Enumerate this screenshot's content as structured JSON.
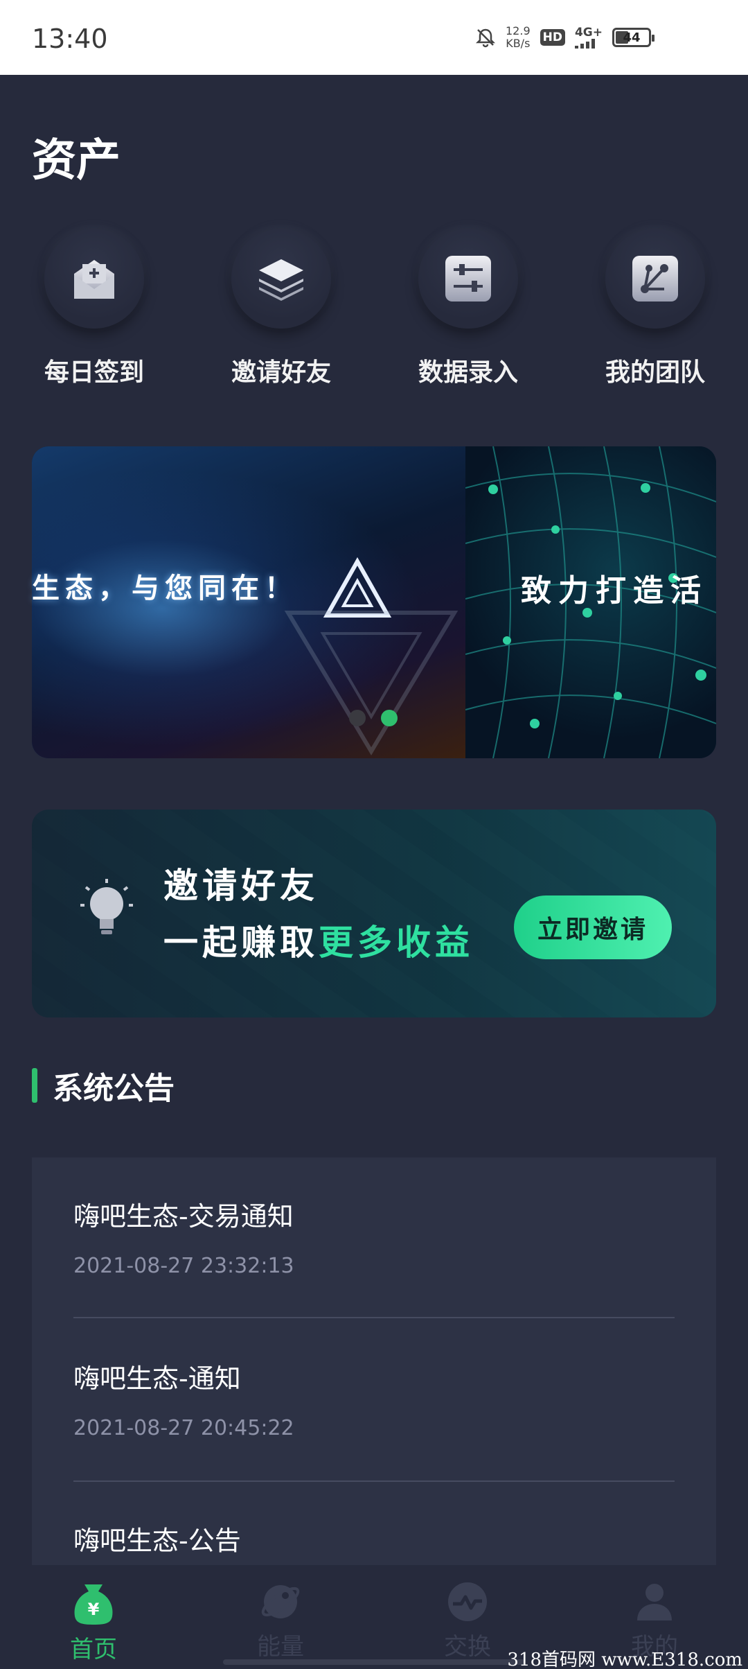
{
  "status_bar": {
    "time": "13:40",
    "speed_value": "12.9",
    "speed_unit": "KB/s",
    "hd": "HD",
    "network": "4G+",
    "battery": "44"
  },
  "page": {
    "title": "资产"
  },
  "actions": [
    {
      "label": "每日签到",
      "icon": "mail-plus-icon"
    },
    {
      "label": "邀请好友",
      "icon": "layers-icon"
    },
    {
      "label": "数据录入",
      "icon": "sliders-icon"
    },
    {
      "label": "我的团队",
      "icon": "team-share-icon"
    }
  ],
  "carousel": {
    "slide_a_text": "生态，与您同在！",
    "slide_b_text": "致力打造活",
    "active_index": 1,
    "count": 2
  },
  "invite": {
    "line1": "邀请好友",
    "line2_prefix": "一起赚取",
    "line2_highlight": "更多收益",
    "button": "立即邀请"
  },
  "announcements": {
    "title": "系统公告",
    "items": [
      {
        "title": "嗨吧生态-交易通知",
        "time": "2021-08-27 23:32:13"
      },
      {
        "title": "嗨吧生态-通知",
        "time": "2021-08-27 20:45:22"
      },
      {
        "title": "嗨吧生态-公告",
        "time": ""
      }
    ]
  },
  "nav": {
    "items": [
      {
        "label": "首页",
        "icon": "money-bag-icon",
        "active": true
      },
      {
        "label": "能量",
        "icon": "planet-icon",
        "active": false
      },
      {
        "label": "交换",
        "icon": "exchange-icon",
        "active": false
      },
      {
        "label": "我的",
        "icon": "user-icon",
        "active": false
      }
    ]
  },
  "watermark": "318首码网 www.E318.com",
  "colors": {
    "accent": "#2fbf6e",
    "background": "#262a3c",
    "card": "#2d3245"
  }
}
